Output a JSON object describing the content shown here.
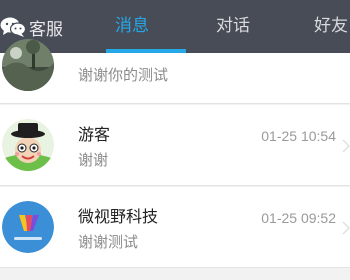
{
  "topbar": {
    "service_label": "客服",
    "tabs": [
      {
        "label": "消息",
        "active": true
      },
      {
        "label": "对话",
        "active": false
      },
      {
        "label": "好友",
        "active": false
      }
    ]
  },
  "colors": {
    "topbar_bg": "#484c57",
    "accent": "#25a8e8",
    "list_bg": "#ffffff",
    "message_text": "#8c8c8c"
  },
  "conversations": [
    {
      "name": "",
      "message": "谢谢你的测试",
      "time": "",
      "avatar_icon": "landscape-photo-avatar"
    },
    {
      "name": "游客",
      "message": "谢谢",
      "time": "01-25 10:54",
      "avatar_icon": "cartoon-guest-avatar"
    },
    {
      "name": "微视野科技",
      "message": "谢谢测试",
      "time": "01-25 09:52",
      "avatar_icon": "weishiye-logo-avatar"
    }
  ]
}
